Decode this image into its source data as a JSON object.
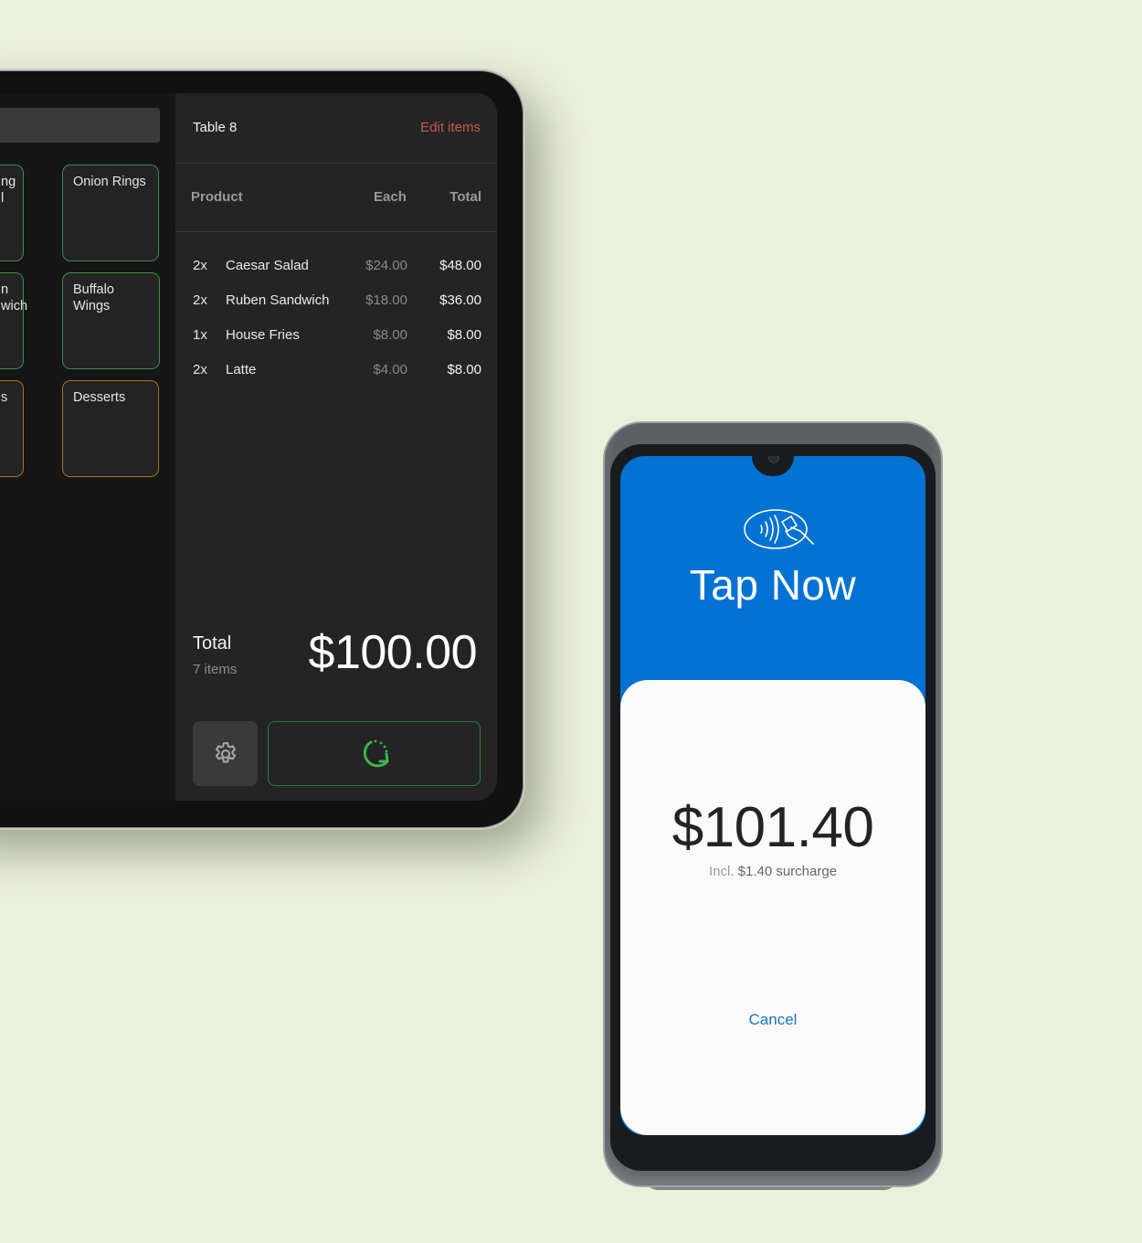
{
  "tablet": {
    "menu_tiles": [
      {
        "label": "ng\nl",
        "partial": true,
        "border": "green"
      },
      {
        "label": "Onion Rings",
        "partial": false,
        "border": "green"
      },
      {
        "label": "n\nwich",
        "partial": true,
        "border": "green"
      },
      {
        "label": "Buffalo Wings",
        "partial": false,
        "border": "green"
      },
      {
        "label": "s",
        "partial": true,
        "border": "orange"
      },
      {
        "label": "Desserts",
        "partial": false,
        "border": "orange"
      }
    ],
    "order": {
      "table_name": "Table 8",
      "edit_items_label": "Edit items",
      "columns": {
        "product": "Product",
        "each": "Each",
        "total": "Total"
      },
      "items": [
        {
          "qty": "2x",
          "name": "Caesar Salad",
          "each": "$24.00",
          "total": "$48.00"
        },
        {
          "qty": "2x",
          "name": "Ruben Sandwich",
          "each": "$18.00",
          "total": "$36.00"
        },
        {
          "qty": "1x",
          "name": "House Fries",
          "each": "$8.00",
          "total": "$8.00"
        },
        {
          "qty": "2x",
          "name": "Latte",
          "each": "$4.00",
          "total": "$8.00"
        }
      ],
      "total_label": "Total",
      "item_count": "7 items",
      "total_amount": "$100.00"
    },
    "buttons": {
      "settings_icon": "gear-icon",
      "pay_icon": "processing-arrow-icon"
    }
  },
  "terminal": {
    "icon": "contactless-tap-icon",
    "title": "Tap Now",
    "amount": "$101.40",
    "surcharge_prefix": "Incl.",
    "surcharge_text": "$1.40 surcharge",
    "cancel_label": "Cancel"
  },
  "colors": {
    "background": "#ebf0dc",
    "terminal_blue": "#0472d2",
    "edit_accent": "#c65a4e",
    "pay_green": "#3db54a",
    "tile_green": "#3f8a4a",
    "tile_orange": "#a77225",
    "cancel_blue": "#1a73c9"
  }
}
